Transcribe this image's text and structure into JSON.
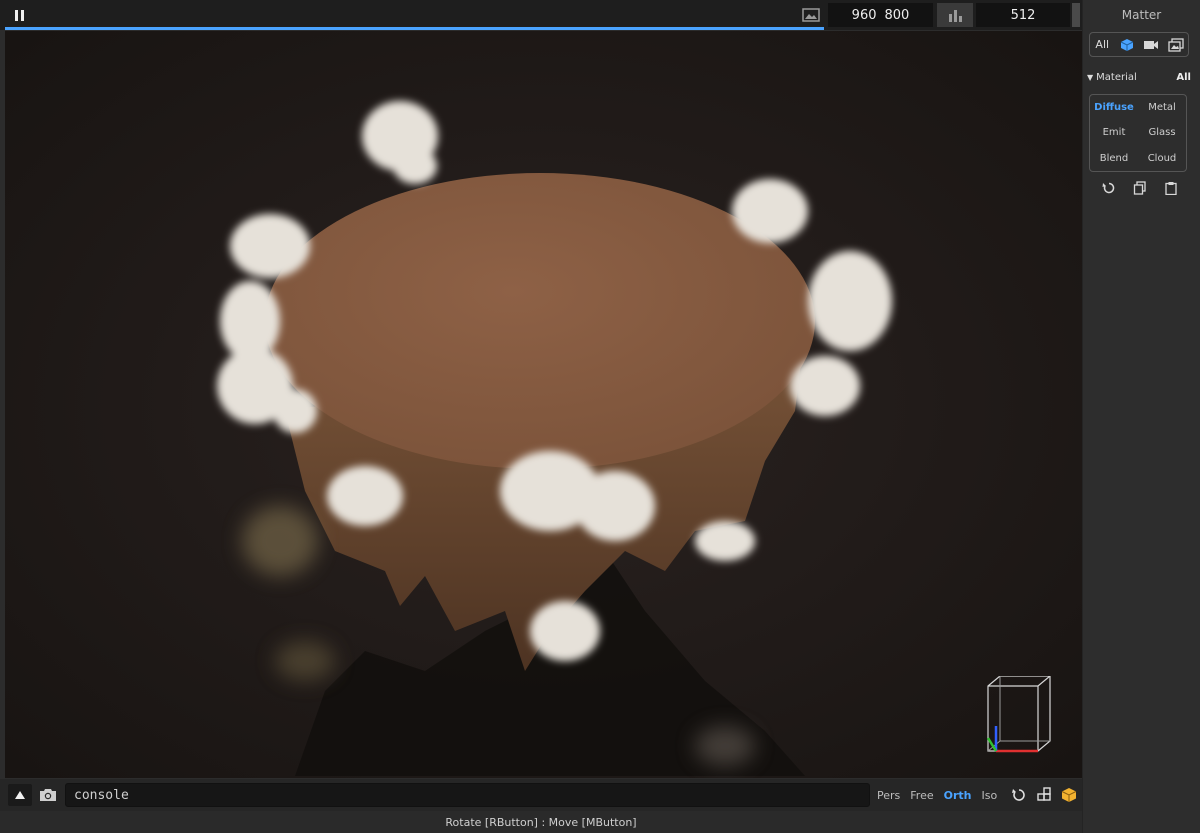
{
  "toolbar": {
    "resolution_width": "960",
    "resolution_height": "800",
    "samples": "512",
    "progress_fraction": 0.76
  },
  "console": {
    "value": "console"
  },
  "view_modes": [
    {
      "label": "Pers",
      "active": false
    },
    {
      "label": "Free",
      "active": false
    },
    {
      "label": "Orth",
      "active": true
    },
    {
      "label": "Iso",
      "active": false
    }
  ],
  "status": {
    "text": "Rotate [RButton] : Move [MButton]"
  },
  "panel": {
    "title": "Matter",
    "filter_all_label": "All",
    "section_label": "Material",
    "section_all_label": "All",
    "materials": [
      {
        "label": "Diffuse",
        "active": true
      },
      {
        "label": "Metal",
        "active": false
      },
      {
        "label": "Emit",
        "active": false
      },
      {
        "label": "Glass",
        "active": false
      },
      {
        "label": "Blend",
        "active": false
      },
      {
        "label": "Cloud",
        "active": false
      }
    ]
  },
  "icons": {
    "pause": "pause-icon",
    "image": "image-icon",
    "chart": "bar-chart-icon",
    "up": "triangle-up-icon",
    "camera": "camera-icon",
    "reset_view": "rotate-reset-icon",
    "layout": "grid-layout-icon",
    "box": "box-icon",
    "cube_filter": "cube-icon",
    "video_filter": "video-icon",
    "images_filter": "images-icon",
    "undo": "undo-icon",
    "copy": "copy-icon",
    "paste": "paste-icon"
  },
  "colors": {
    "accent": "#4aa3ff",
    "terrain_top": "#8a5e43",
    "terrain_side": "#6b4a34",
    "cloud": "#e8e4de",
    "viewport_bg": "#1f1a18",
    "gizmo_x": "#e03030",
    "gizmo_y": "#30c030",
    "gizmo_z": "#3060ff"
  }
}
